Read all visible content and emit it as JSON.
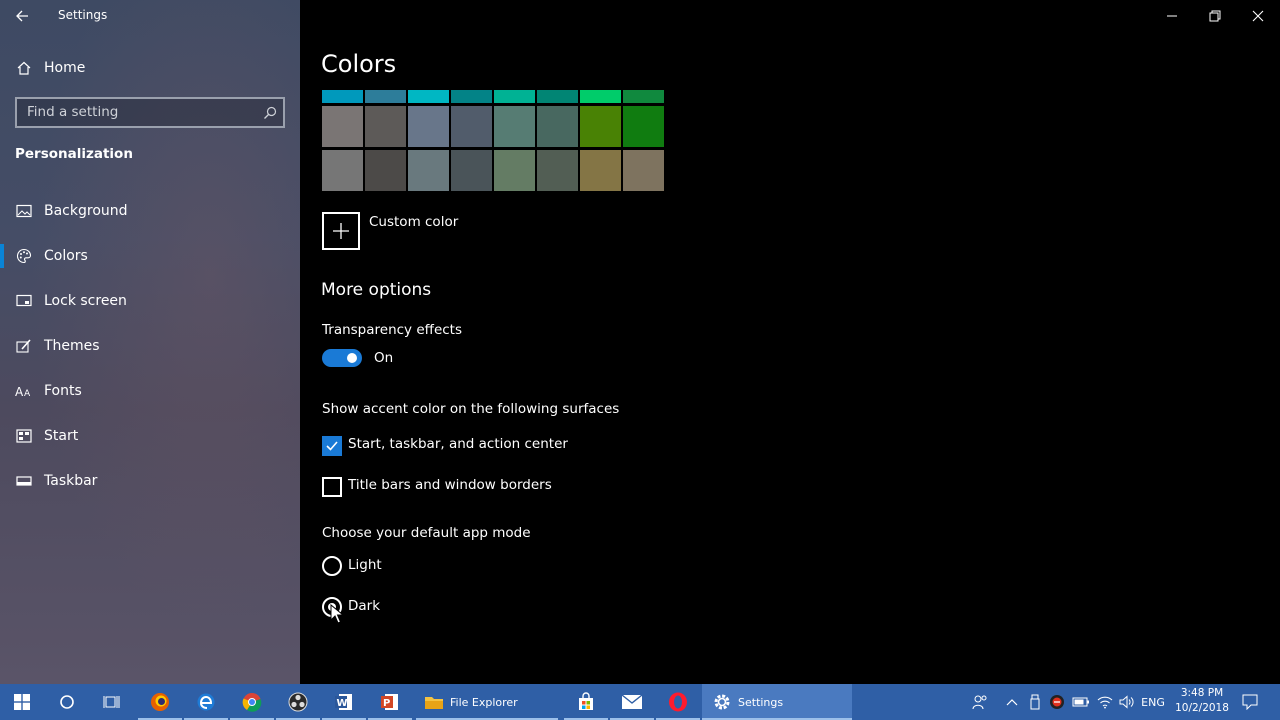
{
  "window": {
    "title": "Settings"
  },
  "sidebar": {
    "home_label": "Home",
    "search_placeholder": "Find a setting",
    "section_title": "Personalization",
    "items": [
      {
        "label": "Background",
        "icon": "picture-icon"
      },
      {
        "label": "Colors",
        "icon": "palette-icon",
        "selected": true
      },
      {
        "label": "Lock screen",
        "icon": "lock-screen-icon"
      },
      {
        "label": "Themes",
        "icon": "brush-icon"
      },
      {
        "label": "Fonts",
        "icon": "font-icon"
      },
      {
        "label": "Start",
        "icon": "start-menu-icon"
      },
      {
        "label": "Taskbar",
        "icon": "taskbar-icon"
      }
    ]
  },
  "main": {
    "title": "Colors",
    "swatch_rows": [
      [
        "#0099bc",
        "#2d7d9a",
        "#00b7c3",
        "#038387",
        "#00b294",
        "#018574",
        "#00cc6a",
        "#10893e"
      ],
      [
        "#7a7574",
        "#5d5a58",
        "#68768a",
        "#515c6b",
        "#567c73",
        "#486860",
        "#498205",
        "#107c10"
      ],
      [
        "#767676",
        "#4c4a48",
        "#69797e",
        "#4a5459",
        "#647c64",
        "#525e54",
        "#847545",
        "#7e735f"
      ]
    ],
    "custom_color_label": "Custom color",
    "more_options": "More options",
    "transparency_label": "Transparency effects",
    "transparency_state": "On",
    "accent_surfaces_label": "Show accent color on the following surfaces",
    "checkbox_start": "Start, taskbar, and action center",
    "checkbox_start_checked": true,
    "checkbox_titlebars": "Title bars and window borders",
    "checkbox_titlebars_checked": false,
    "app_mode_label": "Choose your default app mode",
    "radio_light": "Light",
    "radio_dark": "Dark",
    "app_mode_selected": "Dark"
  },
  "taskbar": {
    "file_explorer_label": "File Explorer",
    "settings_label": "Settings",
    "language": "ENG",
    "time": "3:48 PM",
    "date": "10/2/2018"
  },
  "colors": {
    "accent": "#1a7ad6",
    "taskbar": "#2f5fa6"
  }
}
